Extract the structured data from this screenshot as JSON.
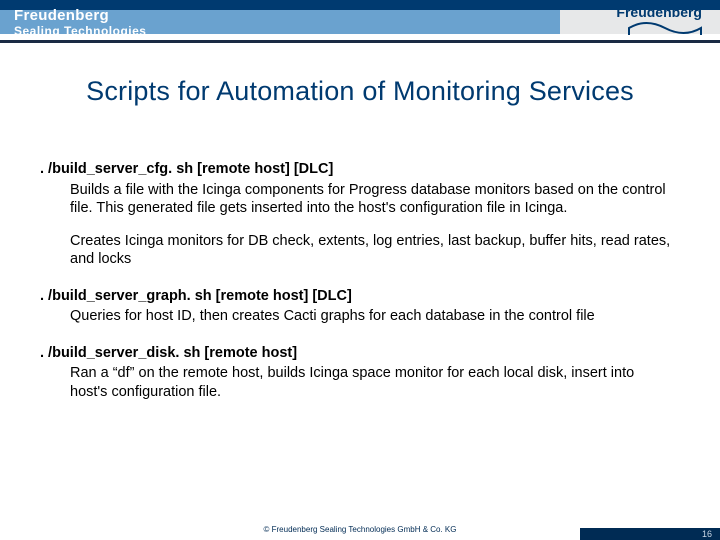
{
  "brand": {
    "left_line1": "Freudenberg",
    "left_line2": "Sealing Technologies",
    "right_name": "Freudenberg"
  },
  "title": "Scripts for Automation of Monitoring Services",
  "scripts": {
    "s1_cmd": ". /build_server_cfg. sh [remote host] [DLC]",
    "s1_desc1": "Builds a file with the Icinga components for Progress database monitors based on the control file. This generated file gets inserted into the host's configuration file in Icinga.",
    "s1_desc2": "Creates Icinga monitors for DB check, extents, log entries, last backup, buffer hits, read rates, and locks",
    "s2_cmd": ". /build_server_graph. sh [remote host] [DLC]",
    "s2_desc": "Queries for host ID, then creates Cacti graphs for each database in the control file",
    "s3_cmd": ". /build_server_disk. sh [remote host]",
    "s3_desc": "Ran a “df” on the remote host, builds Icinga space monitor for each local disk, insert into host's configuration file."
  },
  "footer": {
    "copyright": "© Freudenberg Sealing Technologies GmbH & Co. KG",
    "page": "16"
  },
  "colors": {
    "brand_blue": "#003a70",
    "band_blue": "#6aa2cf",
    "dark_band": "#1a2a44"
  }
}
